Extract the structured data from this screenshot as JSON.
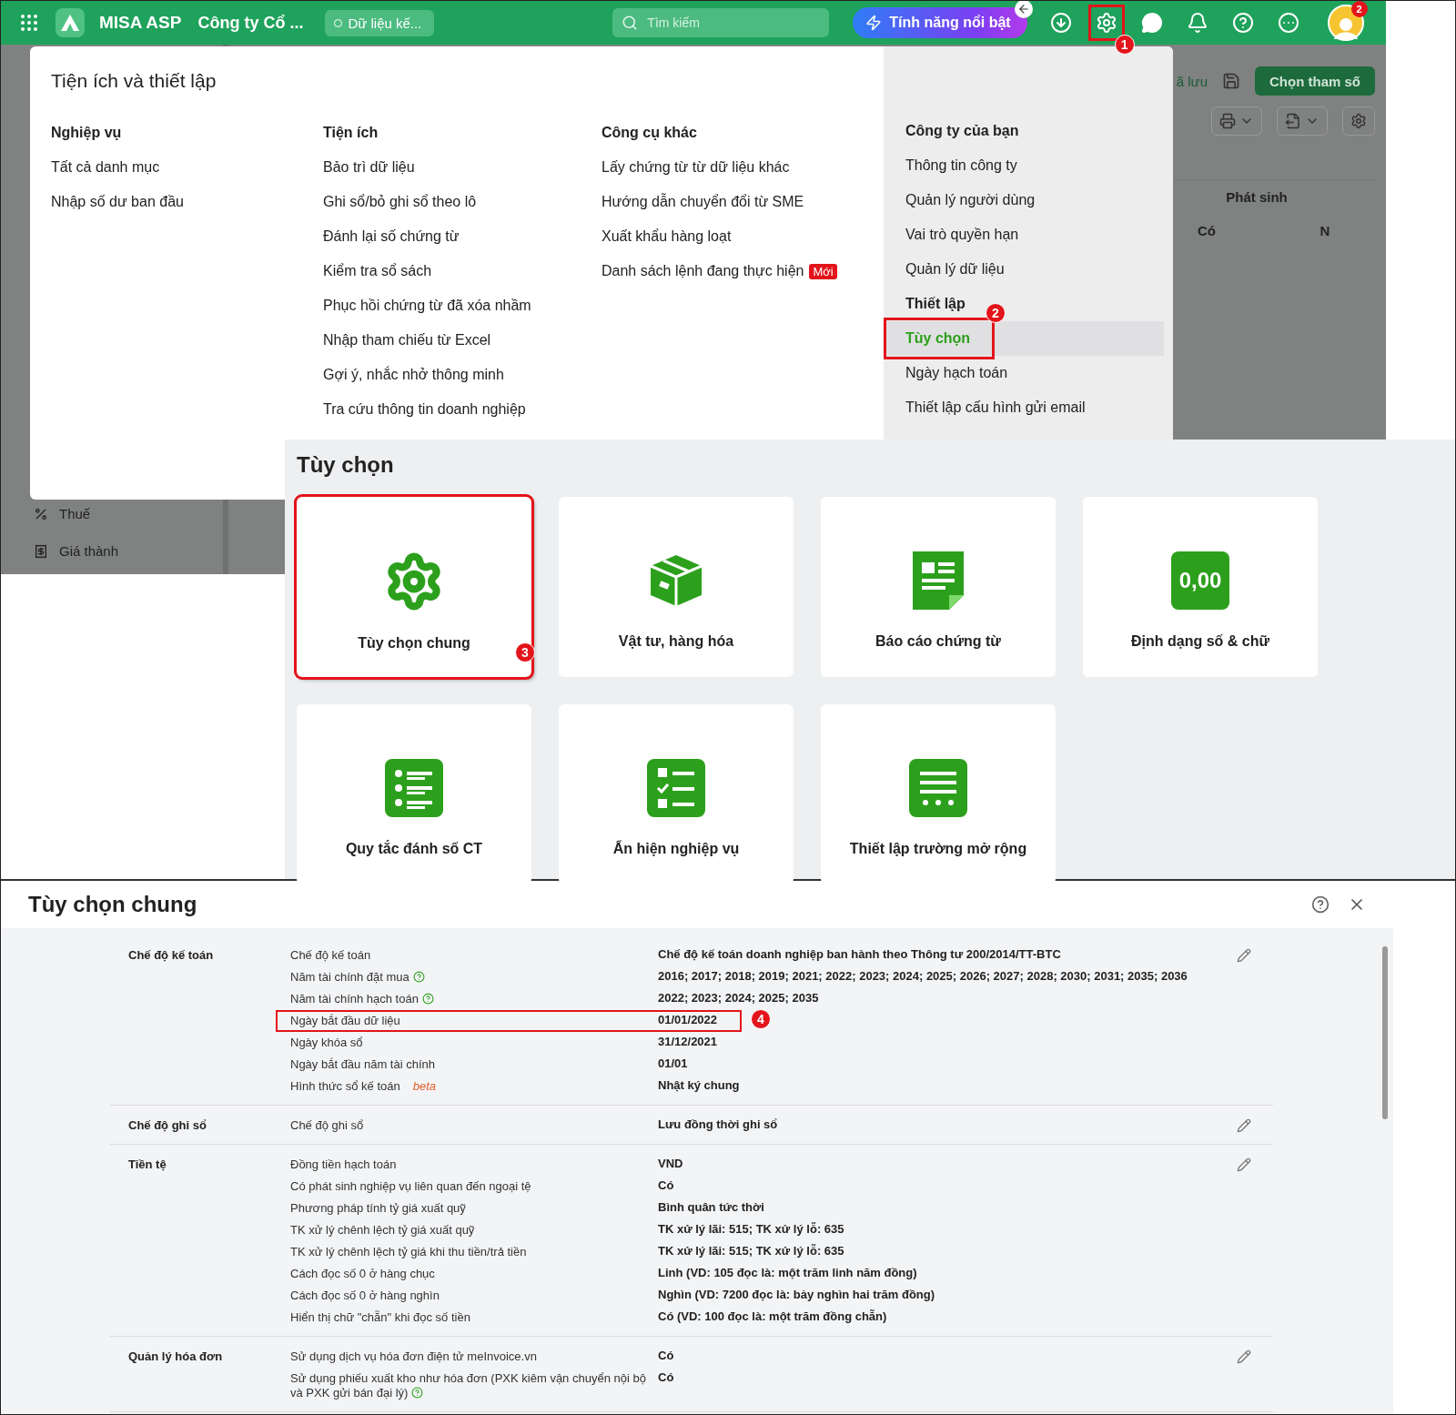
{
  "topbar": {
    "app_name": "MISA ASP",
    "company": "Công ty Cổ ...",
    "data_pill": "Dữ liệu kế...",
    "search": {
      "placeholder": "Tìm kiếm"
    },
    "feature_button": "Tính năng nổi bật",
    "settings_marker": "1",
    "avatar_badge": "2"
  },
  "background": {
    "saved_text": "ã lưu",
    "params_button": "Chọn tham số",
    "column_group": "Phát sinh",
    "columns": [
      "Có",
      "N"
    ],
    "sidebar_items": [
      "Thuế",
      "Giá thành"
    ]
  },
  "menu": {
    "title": "Tiện ích và thiết lập",
    "columns": [
      {
        "heading": "Nghiệp vụ",
        "items": [
          {
            "label": "Tất cả danh mục"
          },
          {
            "label": "Nhập số dư ban đầu"
          }
        ]
      },
      {
        "heading": "Tiện ích",
        "items": [
          {
            "label": "Bảo trì dữ liệu"
          },
          {
            "label": "Ghi sổ/bỏ ghi sổ theo lô"
          },
          {
            "label": "Đánh lại số chứng từ"
          },
          {
            "label": "Kiểm tra sổ sách"
          },
          {
            "label": "Phục hồi chứng từ đã xóa nhầm"
          },
          {
            "label": "Nhập tham chiếu từ Excel"
          },
          {
            "label": "Gợi ý, nhắc nhở thông minh"
          },
          {
            "label": "Tra cứu thông tin doanh nghiệp"
          }
        ]
      },
      {
        "heading": "Công cụ khác",
        "items": [
          {
            "label": "Lấy chứng từ từ dữ liệu khác"
          },
          {
            "label": "Hướng dẫn chuyển đổi từ SME"
          },
          {
            "label": "Xuất khẩu hàng loạt"
          },
          {
            "label": "Danh sách lệnh đang thực hiện",
            "badge": "Mới"
          }
        ]
      }
    ],
    "side": [
      {
        "heading": "Công ty của bạn",
        "items": [
          {
            "label": "Thông tin công ty",
            "selected": false
          },
          {
            "label": "Quản lý người dùng",
            "selected": false
          },
          {
            "label": "Vai trò quyền hạn",
            "selected": false
          },
          {
            "label": "Quản lý dữ liệu",
            "selected": false
          }
        ]
      },
      {
        "heading": "Thiết lập",
        "items": [
          {
            "label": "Tùy chọn",
            "selected": true,
            "marker": "2"
          },
          {
            "label": "Ngày hạch toán",
            "selected": false
          },
          {
            "label": "Thiết lập cấu hình gửi email",
            "selected": false
          }
        ]
      }
    ]
  },
  "options_panel": {
    "title": "Tùy chọn",
    "tiles": [
      {
        "label": "Tùy chọn chung",
        "kind": "gear",
        "marker": "3"
      },
      {
        "label": "Vật tư, hàng hóa",
        "kind": "box"
      },
      {
        "label": "Báo cáo chứng từ",
        "kind": "report"
      },
      {
        "label": "Định dạng số & chữ",
        "kind": "number",
        "icon_text": "0,00"
      },
      {
        "label": "Quy tắc đánh số CT",
        "kind": "numbered-list"
      },
      {
        "label": "Ẩn hiện nghiệp vụ",
        "kind": "checklist"
      },
      {
        "label": "Thiết lập trường mở rộng",
        "kind": "form"
      }
    ]
  },
  "general_options": {
    "title": "Tùy chọn chung",
    "sections": [
      {
        "name": "Chế độ kế toán",
        "rows": [
          {
            "label": "Chế độ kế toán",
            "value": "Chế độ kế toán doanh nghiệp ban hành theo Thông tư 200/2014/TT-BTC"
          },
          {
            "label": "Năm tài chính đặt mua",
            "help": true,
            "value": "2016; 2017; 2018; 2019; 2021; 2022; 2023; 2024; 2025; 2026; 2027; 2028; 2030; 2031; 2035; 2036"
          },
          {
            "label": "Năm tài chính hạch toán",
            "help": true,
            "value": "2022; 2023; 2024; 2025; 2035"
          },
          {
            "label": "Ngày bắt đầu dữ liệu",
            "value": "01/01/2022",
            "marker": "4"
          },
          {
            "label": "Ngày khóa sổ",
            "value": "31/12/2021"
          },
          {
            "label": "Ngày bắt đầu năm tài chính",
            "value": "01/01"
          },
          {
            "label": "Hình thức sổ kế toán",
            "tag": "beta",
            "value": "Nhật ký chung"
          }
        ]
      },
      {
        "name": "Chế độ ghi sổ",
        "rows": [
          {
            "label": "Chế độ ghi sổ",
            "value": "Lưu đồng thời ghi sổ"
          }
        ]
      },
      {
        "name": "Tiền tệ",
        "rows": [
          {
            "label": "Đồng tiền hạch toán",
            "value": "VND"
          },
          {
            "label": "Có phát sinh nghiệp vụ liên quan đến ngoại tệ",
            "value": "Có"
          },
          {
            "label": "Phương pháp tính tỷ giá xuất quỹ",
            "value": "Bình quân tức thời"
          },
          {
            "label": "TK xử lý chênh lệch tỷ giá xuất quỹ",
            "value": "TK xử lý lãi: 515; TK xử lý lỗ: 635"
          },
          {
            "label": "TK xử lý chênh lệch tỷ giá khi thu tiền/trả tiền",
            "value": "TK xử lý lãi: 515; TK xử lý lỗ: 635"
          },
          {
            "label": "Cách đọc số 0 ở hàng chục",
            "value": "Linh (VD: 105 đọc là: một trăm linh năm đồng)"
          },
          {
            "label": "Cách đọc số 0 ở hàng nghìn",
            "value": "Nghìn (VD: 7200 đọc là: bảy nghìn hai trăm đồng)"
          },
          {
            "label": "Hiển thị chữ \"chẵn\" khi đọc số tiền",
            "value": "Có (VD: 100 đọc là: một trăm đồng chẵn)"
          }
        ]
      },
      {
        "name": "Quản lý hóa đơn",
        "rows": [
          {
            "label": "Sử dụng dịch vụ hóa đơn điện tử meInvoice.vn",
            "value": "Có"
          },
          {
            "label": "Sử dụng phiếu xuất kho như hóa đơn (PXK kiêm vận chuyển nội bộ và PXK gửi bán đại lý)",
            "help": true,
            "value": "Có"
          }
        ]
      }
    ]
  }
}
